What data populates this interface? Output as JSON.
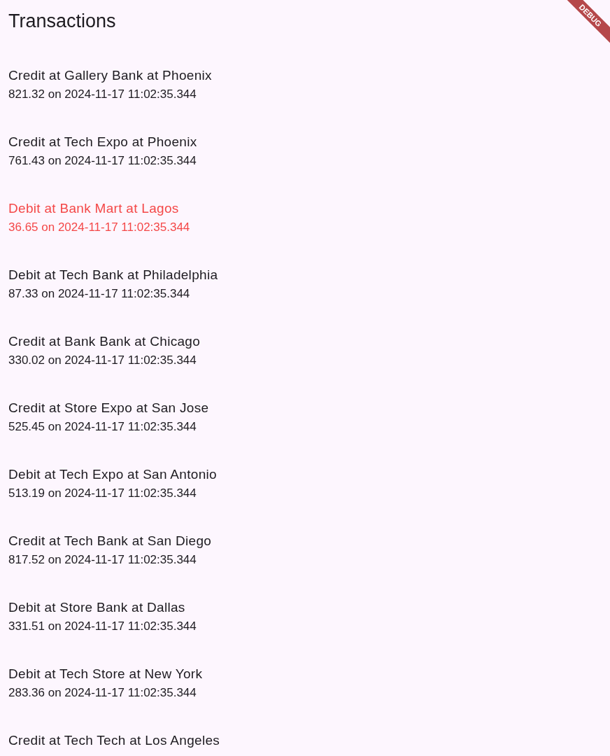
{
  "app_bar": {
    "title": "Transactions"
  },
  "debug_banner": {
    "label": "DEBUG"
  },
  "transactions": [
    {
      "title": "Credit at Gallery Bank at Phoenix",
      "subtitle": "821.32 on 2024-11-17 11:02:35.344",
      "highlighted": false
    },
    {
      "title": "Credit at Tech Expo at Phoenix",
      "subtitle": "761.43 on 2024-11-17 11:02:35.344",
      "highlighted": false
    },
    {
      "title": "Debit at Bank Mart at Lagos",
      "subtitle": "36.65 on 2024-11-17 11:02:35.344",
      "highlighted": true
    },
    {
      "title": "Debit at Tech Bank at Philadelphia",
      "subtitle": "87.33 on 2024-11-17 11:02:35.344",
      "highlighted": false
    },
    {
      "title": "Credit at Bank Bank at Chicago",
      "subtitle": "330.02 on 2024-11-17 11:02:35.344",
      "highlighted": false
    },
    {
      "title": "Credit at Store Expo at San Jose",
      "subtitle": "525.45 on 2024-11-17 11:02:35.344",
      "highlighted": false
    },
    {
      "title": "Debit at Tech Expo at San Antonio",
      "subtitle": "513.19 on 2024-11-17 11:02:35.344",
      "highlighted": false
    },
    {
      "title": "Credit at Tech Bank at San Diego",
      "subtitle": "817.52 on 2024-11-17 11:02:35.344",
      "highlighted": false
    },
    {
      "title": "Debit at Store Bank at Dallas",
      "subtitle": "331.51 on 2024-11-17 11:02:35.344",
      "highlighted": false
    },
    {
      "title": "Debit at Tech Store at New York",
      "subtitle": "283.36 on 2024-11-17 11:02:35.344",
      "highlighted": false
    },
    {
      "title": "Credit at Tech Tech at Los Angeles",
      "highlighted": false
    }
  ]
}
